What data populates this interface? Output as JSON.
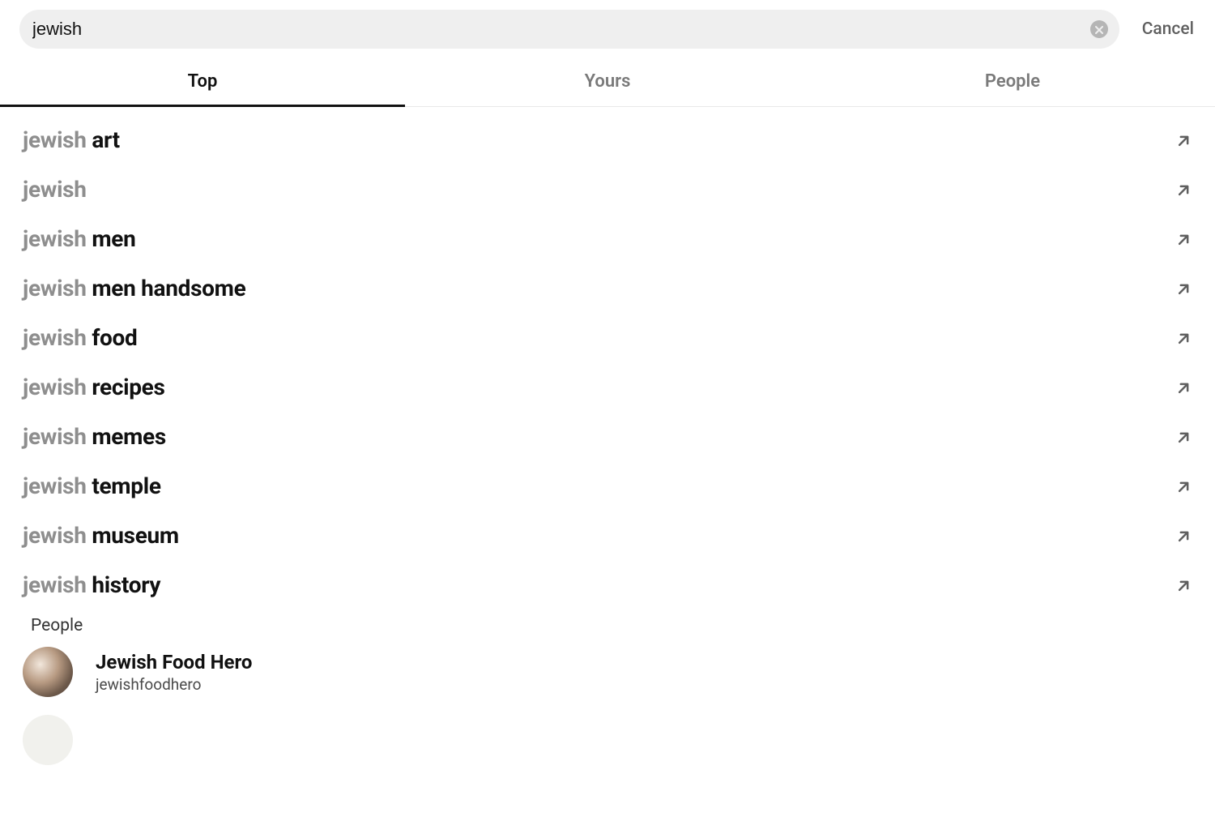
{
  "search": {
    "query": "jewish",
    "cancel_label": "Cancel"
  },
  "tabs": [
    {
      "label": "Top",
      "active": true
    },
    {
      "label": "Yours",
      "active": false
    },
    {
      "label": "People",
      "active": false
    }
  ],
  "suggestions": [
    {
      "prefix": "jewish",
      "completion": " art"
    },
    {
      "prefix": "jewish",
      "completion": ""
    },
    {
      "prefix": "jewish",
      "completion": " men"
    },
    {
      "prefix": "jewish",
      "completion": " men handsome"
    },
    {
      "prefix": "jewish",
      "completion": " food"
    },
    {
      "prefix": "jewish",
      "completion": " recipes"
    },
    {
      "prefix": "jewish",
      "completion": " memes"
    },
    {
      "prefix": "jewish",
      "completion": " temple"
    },
    {
      "prefix": "jewish",
      "completion": " museum"
    },
    {
      "prefix": "jewish",
      "completion": " history"
    }
  ],
  "people_section": {
    "heading": "People",
    "results": [
      {
        "name": "Jewish Food Hero",
        "handle": "jewishfoodhero"
      }
    ]
  }
}
